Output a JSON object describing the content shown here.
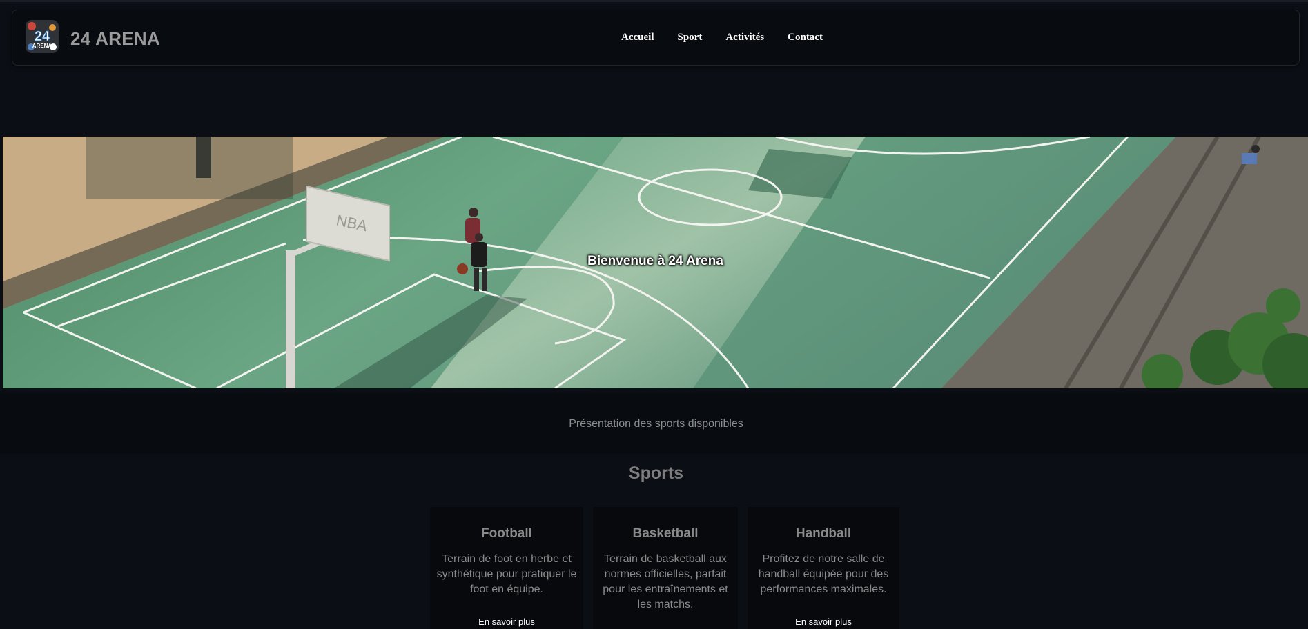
{
  "header": {
    "brand": "24 ARENA",
    "logo_text": "24",
    "logo_subtext": "ARENA",
    "nav": [
      "Accueil",
      "Sport",
      "Activités",
      "Contact"
    ]
  },
  "hero": {
    "title": "Bienvenue à 24 Arena",
    "backboard_text": "NBA"
  },
  "intro": {
    "text": "Présentation des sports disponibles"
  },
  "sports": {
    "title": "Sports",
    "cards": [
      {
        "title": "Football",
        "text": "Terrain de foot en herbe et synthétique pour pratiquer le foot en équipe.",
        "link": "En savoir plus"
      },
      {
        "title": "Basketball",
        "text": "Terrain de basketball aux normes officielles, parfait pour les entraînements et les matchs.",
        "link": ""
      },
      {
        "title": "Handball",
        "text": "Profitez de notre salle de handball équipée pour des performances maximales.",
        "link": "En savoir plus"
      }
    ]
  },
  "colors": {
    "background": "#0b0f15",
    "court": "#5f9a7c",
    "header": "#080b10"
  }
}
